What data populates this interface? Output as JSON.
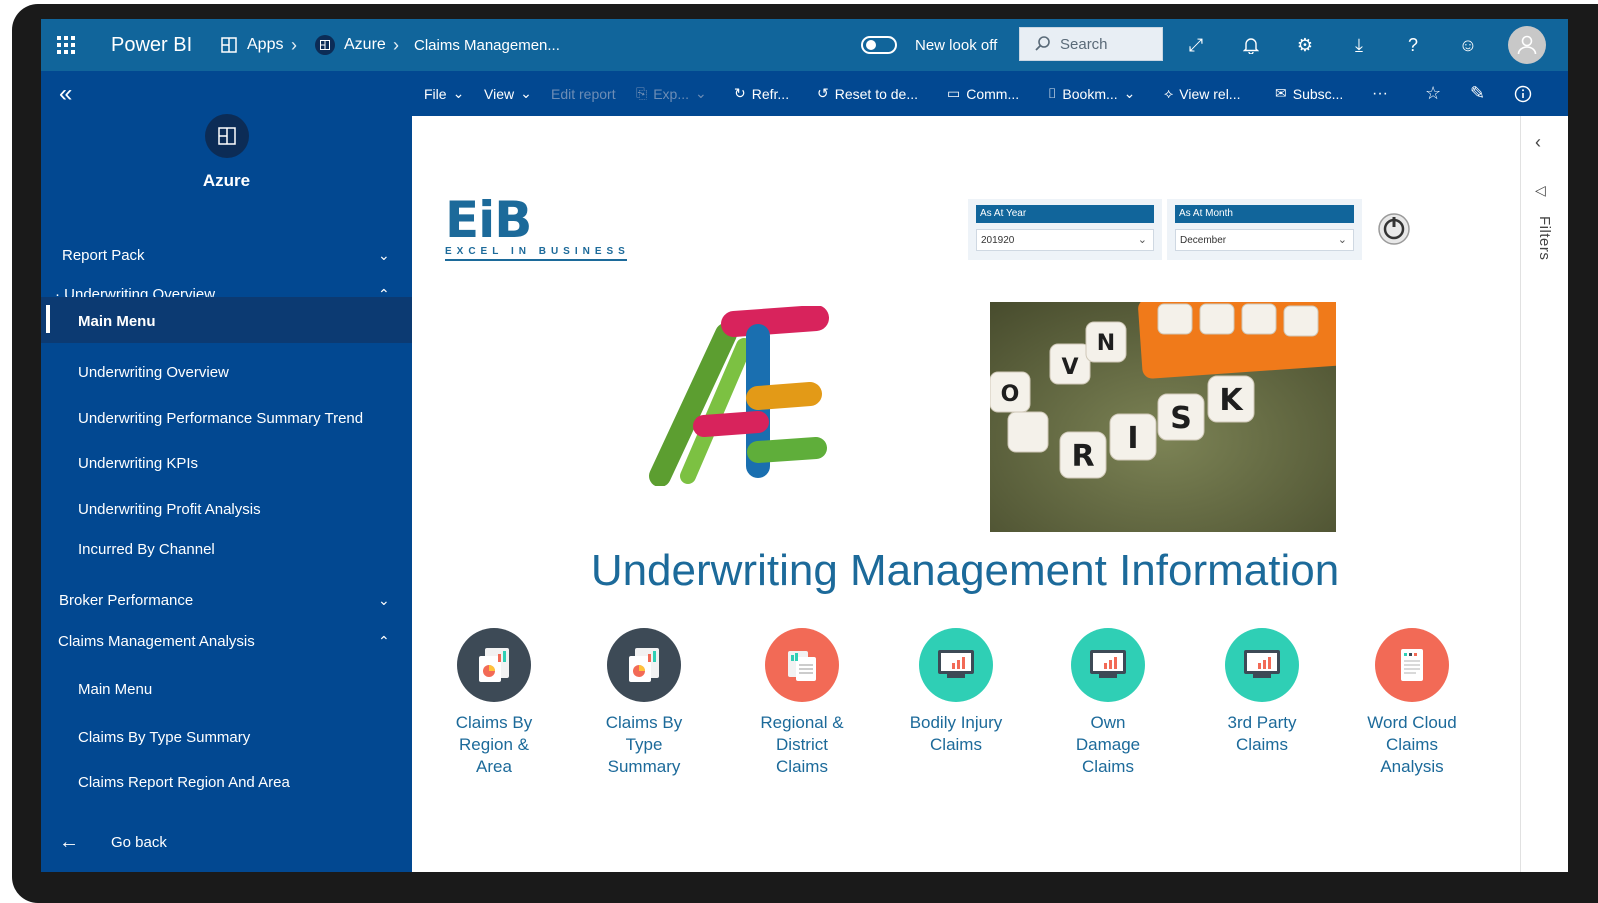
{
  "topbar": {
    "brand": "Power BI",
    "breadcrumbs": [
      "Apps",
      "Azure",
      "Claims Managemen..."
    ],
    "new_look_label": "New look off",
    "search_placeholder": "Search"
  },
  "commands": {
    "file": "File",
    "view": "View",
    "edit_report": "Edit report",
    "export": "Exp...",
    "refresh": "Refr...",
    "reset": "Reset to de...",
    "comments": "Comm...",
    "bookmarks": "Bookm...",
    "view_related": "View rel...",
    "subscribe": "Subsc...",
    "more": "···"
  },
  "nav": {
    "workspace_name": "Azure",
    "sections": [
      {
        "label": "Report Pack"
      },
      {
        "label": "· Underwriting Overview"
      }
    ],
    "underwriting_items": [
      "Main Menu",
      "Underwriting Overview",
      "Underwriting Performance Summary Trend",
      "Underwriting KPIs",
      "Underwriting Profit Analysis",
      "Incurred By Channel"
    ],
    "broker": "Broker Performance",
    "claims": "Claims Management Analysis",
    "claims_items": [
      "Main Menu",
      "Claims By Type Summary",
      "Claims Report Region And Area"
    ],
    "go_back": "Go back"
  },
  "report": {
    "logo_letters": "EiB",
    "logo_tagline": "EXCEL IN BUSINESS",
    "slicers": {
      "year_label": "As At Year",
      "year_value": "201920",
      "month_label": "As At Month",
      "month_value": "December"
    },
    "dice_letters": [
      "R",
      "I",
      "S",
      "K",
      "V",
      "O",
      "N"
    ],
    "title": "Underwriting Management Information",
    "tiles": [
      {
        "line1": "Claims By",
        "line2": "Region &",
        "line3": "Area",
        "icon": "report-charts-icon",
        "color": "#3d4a56"
      },
      {
        "line1": "Claims By",
        "line2": "Type",
        "line3": "Summary",
        "icon": "report-charts-icon",
        "color": "#3d4a56"
      },
      {
        "line1": "Regional &",
        "line2": "District",
        "line3": "Claims",
        "icon": "documents-icon",
        "color": "#f26a56"
      },
      {
        "line1": "Bodily Injury",
        "line2": "Claims",
        "line3": "",
        "icon": "monitor-chart-icon",
        "color": "#2fcfb5"
      },
      {
        "line1": "Own",
        "line2": "Damage",
        "line3": "Claims",
        "icon": "monitor-chart-icon",
        "color": "#2fcfb5"
      },
      {
        "line1": "3rd Party",
        "line2": "Claims",
        "line3": "",
        "icon": "monitor-chart-icon",
        "color": "#2fcfb5"
      },
      {
        "line1": "Word Cloud",
        "line2": "Claims",
        "line3": "Analysis",
        "icon": "document-icon",
        "color": "#f26a56"
      }
    ]
  },
  "filters_label": "Filters"
}
